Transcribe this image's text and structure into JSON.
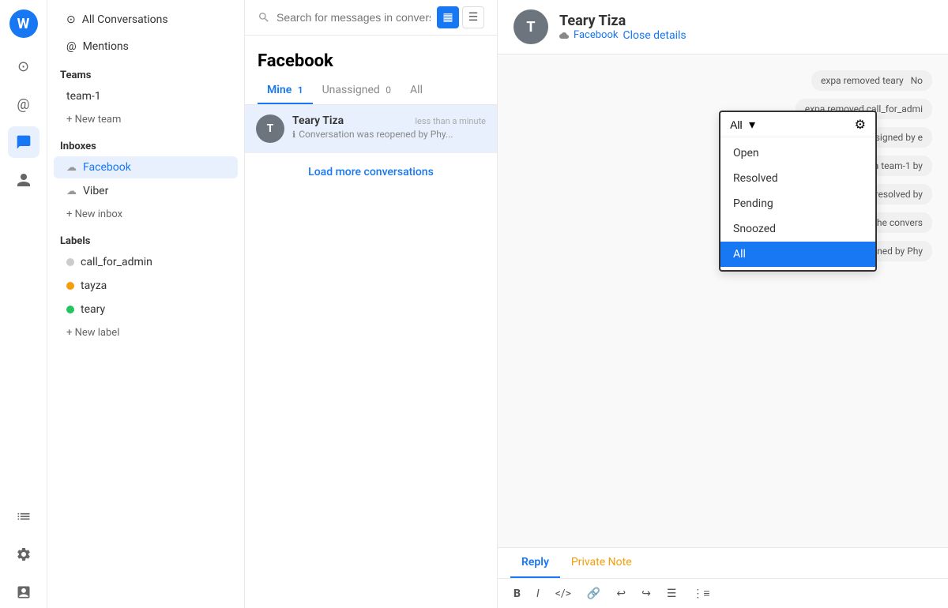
{
  "app": {
    "logo": "W"
  },
  "iconbar": {
    "items": [
      {
        "name": "home-icon",
        "symbol": "⊙",
        "active": false
      },
      {
        "name": "mention-icon",
        "symbol": "@",
        "active": false
      },
      {
        "name": "conversation-icon",
        "symbol": "💬",
        "active": true
      },
      {
        "name": "contacts-icon",
        "symbol": "👤",
        "active": false
      },
      {
        "name": "reports-icon",
        "symbol": "📈",
        "active": false
      },
      {
        "name": "settings-icon",
        "symbol": "⚙",
        "active": false
      },
      {
        "name": "campaigns-icon",
        "symbol": "📋",
        "active": false
      }
    ]
  },
  "sidebar": {
    "all_conversations": "All Conversations",
    "mentions": "Mentions",
    "teams_title": "Teams",
    "teams": [
      {
        "name": "team-1",
        "label": "team-1"
      }
    ],
    "new_team": "+ New team",
    "inboxes_title": "Inboxes",
    "inboxes": [
      {
        "name": "facebook",
        "label": "Facebook",
        "active": true
      },
      {
        "name": "viber",
        "label": "Viber"
      }
    ],
    "new_inbox": "+ New inbox",
    "labels_title": "Labels",
    "labels": [
      {
        "name": "call_for_admin",
        "label": "call_for_admin",
        "color": "#cccccc"
      },
      {
        "name": "tayza",
        "label": "tayza",
        "color": "#f59e0b"
      },
      {
        "name": "teary",
        "label": "teary",
        "color": "#22c55e"
      }
    ],
    "new_label": "+ New label"
  },
  "conv_list": {
    "search_placeholder": "Search for messages in conversations",
    "title": "Facebook",
    "tabs": [
      {
        "label": "Mine",
        "count": "1",
        "active": true
      },
      {
        "label": "Unassigned",
        "count": "0",
        "active": false
      },
      {
        "label": "All",
        "count": "",
        "active": false
      }
    ],
    "filter": {
      "options": [
        "All",
        "Open",
        "Resolved",
        "Pending",
        "Snoozed"
      ],
      "selected": "All"
    },
    "conversations": [
      {
        "name": "Teary Tiza",
        "snippet": "Conversation was reopened by Phy...",
        "time": "less than a minute",
        "active": true
      }
    ],
    "load_more": "Load more conversations"
  },
  "dropdown": {
    "options": [
      {
        "label": "Open",
        "selected": false
      },
      {
        "label": "Resolved",
        "selected": false
      },
      {
        "label": "Pending",
        "selected": false
      },
      {
        "label": "Snoozed",
        "selected": false
      },
      {
        "label": "All",
        "selected": true
      }
    ],
    "all_label": "All"
  },
  "chat": {
    "header": {
      "name": "Teary Tiza",
      "platform": "Facebook",
      "close_details": "Close details"
    },
    "messages": [
      {
        "text": "expa removed teary  No",
        "type": "system"
      },
      {
        "text": "expa removed call_for_admi",
        "type": "system"
      },
      {
        "text": "Conversation unassigned by e",
        "type": "system"
      },
      {
        "text": "Assigned to Phyoe Lay via team-1 by",
        "type": "system"
      },
      {
        "text": "Conversation was marked resolved by",
        "type": "system"
      },
      {
        "text": "Phyoe Lay has muted the convers",
        "type": "system"
      },
      {
        "text": "Conversation was reopened by Phy",
        "type": "system"
      }
    ],
    "reply_tabs": [
      {
        "label": "Reply",
        "active": true,
        "type": "reply"
      },
      {
        "label": "Private Note",
        "active": false,
        "type": "private"
      }
    ],
    "toolbar": [
      {
        "name": "bold-btn",
        "symbol": "B",
        "style": "bold"
      },
      {
        "name": "italic-btn",
        "symbol": "I",
        "style": "italic"
      },
      {
        "name": "code-btn",
        "symbol": "</>",
        "style": ""
      },
      {
        "name": "link-btn",
        "symbol": "🔗",
        "style": ""
      },
      {
        "name": "undo-btn",
        "symbol": "↩",
        "style": ""
      },
      {
        "name": "redo-btn",
        "symbol": "↪",
        "style": ""
      },
      {
        "name": "list-btn",
        "symbol": "≡",
        "style": ""
      },
      {
        "name": "ordered-list-btn",
        "symbol": "⋮≡",
        "style": ""
      }
    ]
  }
}
